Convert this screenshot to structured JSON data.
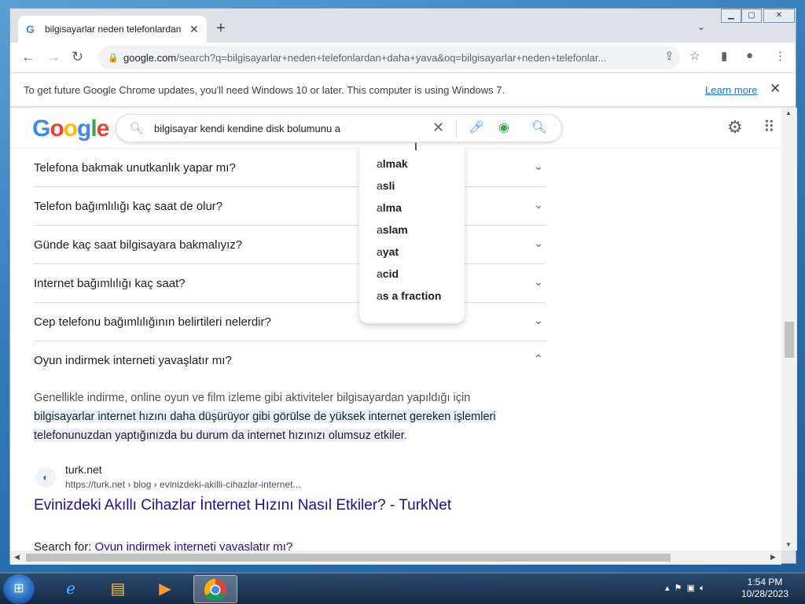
{
  "browser": {
    "tab_title": "bilgisayarlar neden telefonlardan",
    "tab_favicon": "G",
    "url_host": "google.com",
    "url_rest": "/search?q=bilgisayarlar+neden+telefonlardan+daha+yava&oq=bilgisayarlar+neden+telefonlar...",
    "infobar_text": "To get future Google Chrome updates, you'll need Windows 10 or later. This computer is using Windows 7.",
    "infobar_link": "Learn more"
  },
  "search": {
    "query": "bilgisayar kendi kendine disk bolumunu a",
    "suggestions": [
      {
        "prefix": "a",
        "rest": "lmak"
      },
      {
        "prefix": "a",
        "rest": "sli"
      },
      {
        "prefix": "a",
        "rest": "lma"
      },
      {
        "prefix": "a",
        "rest": "slam"
      },
      {
        "prefix": "a",
        "rest": "yat"
      },
      {
        "prefix": "a",
        "rest": "cid"
      },
      {
        "prefix": "a",
        "rest": "s a fraction"
      }
    ]
  },
  "logo": {
    "letters": [
      "G",
      "o",
      "o",
      "g",
      "l",
      "e"
    ]
  },
  "faq": [
    {
      "question": "Telefona bakmak unutkanlık yapar mı?",
      "expanded": false
    },
    {
      "question": "Telefon bağımlılığı kaç saat de olur?",
      "expanded": false
    },
    {
      "question": "Günde kaç saat bilgisayara bakmalıyız?",
      "expanded": false
    },
    {
      "question": "Internet bağımlılığı kaç saat?",
      "expanded": false
    },
    {
      "question": "Cep telefonu bağımlılığının belirtileri nelerdir?",
      "expanded": false
    },
    {
      "question": "Oyun indirmek interneti yavaşlatır mı?",
      "expanded": true
    }
  ],
  "answer": {
    "plain": "Genellikle indirme, online oyun ve film izleme gibi aktiviteler bilgisayardan yapıldığı için ",
    "highlight": "bilgisayarlar internet hızını daha düşürüyor gibi görülse de yüksek internet gereken işlemleri telefonunuzdan yaptığınızda bu durum da internet hızınızı olumsuz etkiler",
    "end": "."
  },
  "source": {
    "site": "turk.net",
    "cite": "https://turk.net › blog › evinizdeki-akilli-cihazlar-internet...",
    "title": "Evinizdeki Akıllı Cihazlar İnternet Hızını Nasıl Etkiler? - TurkNet"
  },
  "search_for": {
    "label": "Search for:",
    "link": "Oyun indirmek interneti yavaşlatır mı?"
  },
  "taskbar": {
    "time": "1:54 PM",
    "date": "10/28/2023"
  }
}
